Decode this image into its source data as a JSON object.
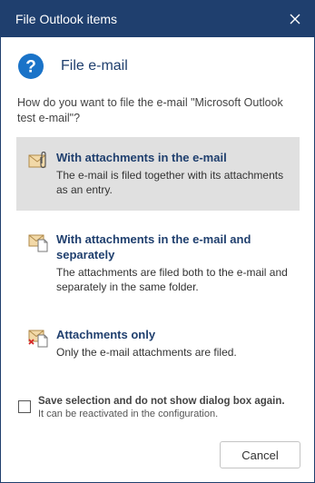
{
  "window": {
    "title": "File Outlook items"
  },
  "header": {
    "icon": "help-icon",
    "text": "File e-mail"
  },
  "question": "How do you want to file the e-mail \"Microsoft Outlook test e-mail\"?",
  "options": [
    {
      "icon": "mail-with-attachment-icon",
      "title": "With attachments in the e-mail",
      "description": "The e-mail is filed together with its attachments as an entry.",
      "selected": true
    },
    {
      "icon": "mail-and-attachment-icon",
      "title": "With attachments in the e-mail and separately",
      "description": "The attachments are filed both to the e-mail and separately in the same folder.",
      "selected": false
    },
    {
      "icon": "attachments-only-icon",
      "title": "Attachments only",
      "description": "Only the e-mail attachments are filed.",
      "selected": false
    }
  ],
  "save_selection": {
    "label": "Save selection and do not show dialog box again.",
    "sub": "It can be reactivated in the configuration.",
    "checked": false
  },
  "buttons": {
    "cancel": "Cancel"
  },
  "colors": {
    "titlebar": "#1f3f6e",
    "accent": "#1a73c8",
    "selected_bg": "#e0e0e0"
  }
}
